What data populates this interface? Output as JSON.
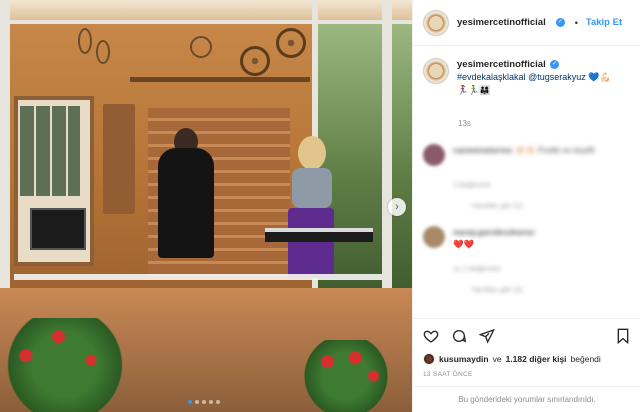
{
  "header": {
    "username": "yesimercetinofficial",
    "separator": "•",
    "follow_label": "Takip Et"
  },
  "caption": {
    "username": "yesimercetinofficial",
    "hashtag": "#evdekalaşklakal",
    "mention": "@tugserakyuz",
    "emoji_suffix": "💙💪🏻",
    "emoji_line": "🏃‍♀️🏃‍♂️👨‍👩‍👧",
    "time": "13s"
  },
  "comments": [
    {
      "user": "carmenstorres",
      "text": "👏🏻👏🏻 Pratik ve keyifli",
      "meta": "1 beğenme",
      "replies": "Yanıtları gör (1)",
      "avatar_color": "#8a5a6a"
    },
    {
      "user": "nuray.gorukcuhoroz",
      "text": "❤️❤️",
      "meta": "1s   1 beğenme",
      "replies": "Yanıtları gör (2)",
      "avatar_color": "#a88a6a"
    }
  ],
  "likes": {
    "user": "kusumaydin",
    "joiner": "ve",
    "count": "1.182 diğer kişi",
    "suffix": "beğendi"
  },
  "post_time": "13 SAAT ÖNCE",
  "restricted_text": "Bu gönderideki yorumlar sınırlandırıldı.",
  "carousel": {
    "total": 5,
    "active": 1
  },
  "colors": {
    "accent": "#3897f0",
    "link": "#00376b",
    "muted": "#8e8e8e"
  }
}
